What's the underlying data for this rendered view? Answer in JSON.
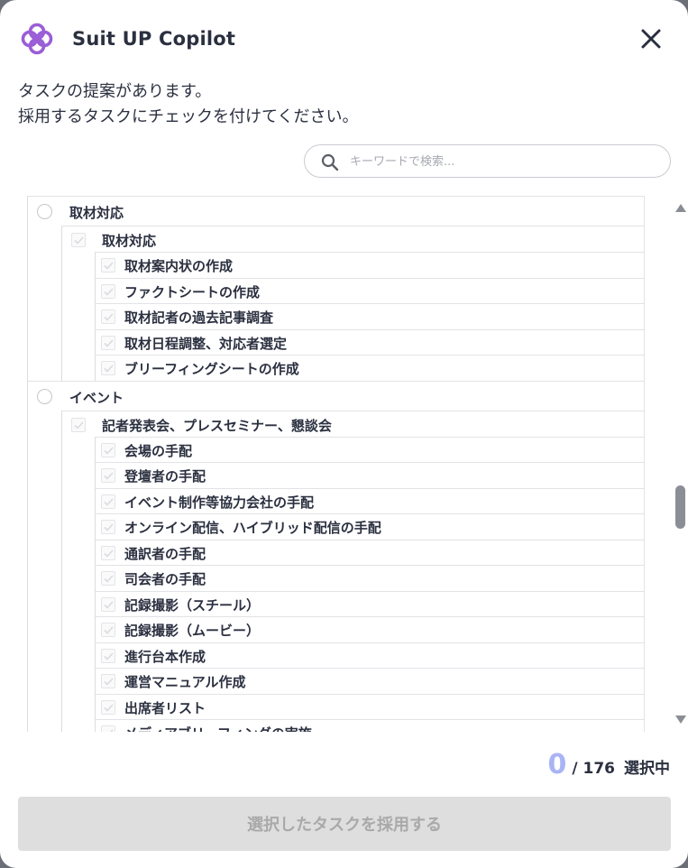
{
  "header": {
    "title": "Suit UP Copilot",
    "logo_icon": "logo-icon",
    "close_icon": "close-icon"
  },
  "intro": {
    "line1": "タスクの提案があります。",
    "line2": "採用するタスクにチェックを付けてください。"
  },
  "search": {
    "placeholder": "キーワードで検索..."
  },
  "categories": [
    {
      "label": "取材対応",
      "groups": [
        {
          "label": "取材対応",
          "items": [
            "取材案内状の作成",
            "ファクトシートの作成",
            "取材記者の過去記事調査",
            "取材日程調整、対応者選定",
            "ブリーフィングシートの作成"
          ]
        }
      ]
    },
    {
      "label": "イベント",
      "groups": [
        {
          "label": "記者発表会、プレスセミナー、懇談会",
          "items": [
            "会場の手配",
            "登壇者の手配",
            "イベント制作等協力会社の手配",
            "オンライン配信、ハイブリッド配信の手配",
            "通訳者の手配",
            "司会者の手配",
            "記録撮影（スチール）",
            "記録撮影（ムービー）",
            "進行台本作成",
            "運営マニュアル作成",
            "出席者リスト",
            "メディアブリーフィングの実施"
          ]
        }
      ]
    }
  ],
  "counter": {
    "selected": "0",
    "total": "/ 176",
    "label": "選択中"
  },
  "footer": {
    "adopt_button": "選択したタスクを採用する"
  },
  "colors": {
    "accent": "#a8b4f5",
    "logo": "#9a5ed6",
    "disabled_button": "#dedede"
  }
}
